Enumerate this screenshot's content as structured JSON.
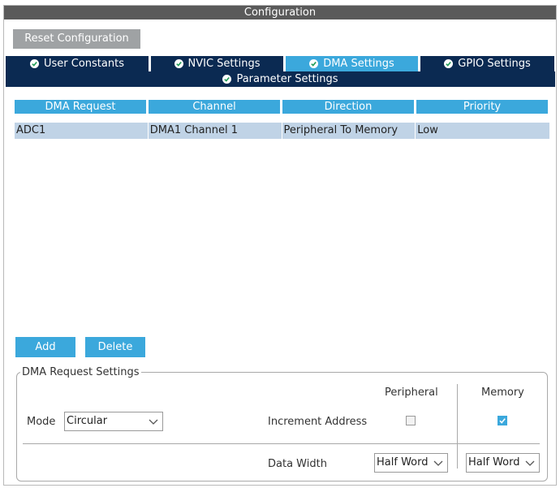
{
  "window": {
    "title": "Configuration"
  },
  "toolbar": {
    "reset_label": "Reset Configuration"
  },
  "tabs": {
    "row1": [
      {
        "label": "User Constants",
        "icon": "check-circle-icon",
        "active": false
      },
      {
        "label": "NVIC Settings",
        "icon": "check-circle-icon",
        "active": false
      },
      {
        "label": "DMA Settings",
        "icon": "check-circle-icon",
        "active": true
      },
      {
        "label": "GPIO Settings",
        "icon": "check-circle-icon",
        "active": false
      }
    ],
    "row2": [
      {
        "label": "Parameter Settings",
        "icon": "check-circle-icon",
        "active": false
      }
    ]
  },
  "table": {
    "columns": [
      "DMA Request",
      "Channel",
      "Direction",
      "Priority"
    ],
    "rows": [
      [
        "ADC1",
        "DMA1 Channel 1",
        "Peripheral To Memory",
        "Low"
      ]
    ]
  },
  "actions": {
    "add_label": "Add",
    "delete_label": "Delete"
  },
  "dma_settings": {
    "group_title": "DMA Request Settings",
    "mode_label": "Mode",
    "mode_value": "Circular",
    "peripheral_header": "Peripheral",
    "memory_header": "Memory",
    "increment_label": "Increment Address",
    "peripheral_increment": false,
    "memory_increment": true,
    "data_width_label": "Data Width",
    "peripheral_data_width": "Half Word",
    "memory_data_width": "Half Word"
  },
  "colors": {
    "accent": "#3ba8dc",
    "tab_dark": "#0b2a52",
    "selected_row": "#c0d3e6",
    "title_bar": "#5a5a5a",
    "button_gray": "#9fa2a4"
  }
}
